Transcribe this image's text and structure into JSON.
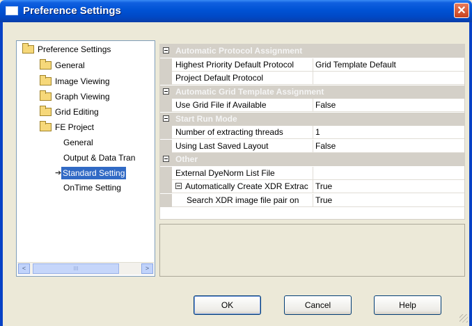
{
  "window": {
    "title": "Preference Settings",
    "close_label": "✕"
  },
  "tree": {
    "items": [
      {
        "label": "Preference Settings",
        "level": 0,
        "icon": "folder-open-icon"
      },
      {
        "label": "General",
        "level": 1,
        "icon": "folder-icon"
      },
      {
        "label": "Image Viewing",
        "level": 1,
        "icon": "folder-icon"
      },
      {
        "label": "Graph Viewing",
        "level": 1,
        "icon": "folder-icon"
      },
      {
        "label": "Grid Editing",
        "level": 1,
        "icon": "folder-icon"
      },
      {
        "label": "FE Project",
        "level": 1,
        "icon": "folder-open-icon"
      },
      {
        "label": "General",
        "level": 2
      },
      {
        "label": "Output & Data Tran",
        "level": 2
      },
      {
        "label": "Standard Setting",
        "level": 2,
        "selected": true,
        "icon": "arrow-icon"
      },
      {
        "label": "OnTime Setting",
        "level": 2
      }
    ],
    "scroll_left": "<",
    "scroll_right": ">",
    "scroll_thumb": "III"
  },
  "grid": {
    "rows": [
      {
        "type": "category",
        "label": "Automatic Protocol Assignment"
      },
      {
        "type": "prop",
        "name": "Highest Priority Default Protocol",
        "value": "Grid Template Default"
      },
      {
        "type": "prop",
        "name": "Project Default Protocol",
        "value": ""
      },
      {
        "type": "category",
        "label": "Automatic Grid Template Assignment"
      },
      {
        "type": "prop",
        "name": "Use Grid File if Available",
        "value": "False"
      },
      {
        "type": "category",
        "label": "Start Run Mode"
      },
      {
        "type": "prop",
        "name": "Number of extracting threads",
        "value": "1"
      },
      {
        "type": "prop",
        "name": "Using Last Saved Layout",
        "value": "False"
      },
      {
        "type": "category",
        "label": "Other"
      },
      {
        "type": "prop",
        "name": "External DyeNorm List File",
        "value": ""
      },
      {
        "type": "prop",
        "name": "Automatically Create XDR Extrac",
        "value": "True",
        "expandable": true
      },
      {
        "type": "prop",
        "name": "Search XDR image file pair on",
        "value": "True",
        "indent": true
      }
    ]
  },
  "buttons": {
    "ok": "OK",
    "cancel": "Cancel",
    "help": "Help"
  },
  "colors": {
    "selection": "#316ac5",
    "titlebar": "#0052d4",
    "category_bg": "#d4d0c8"
  }
}
